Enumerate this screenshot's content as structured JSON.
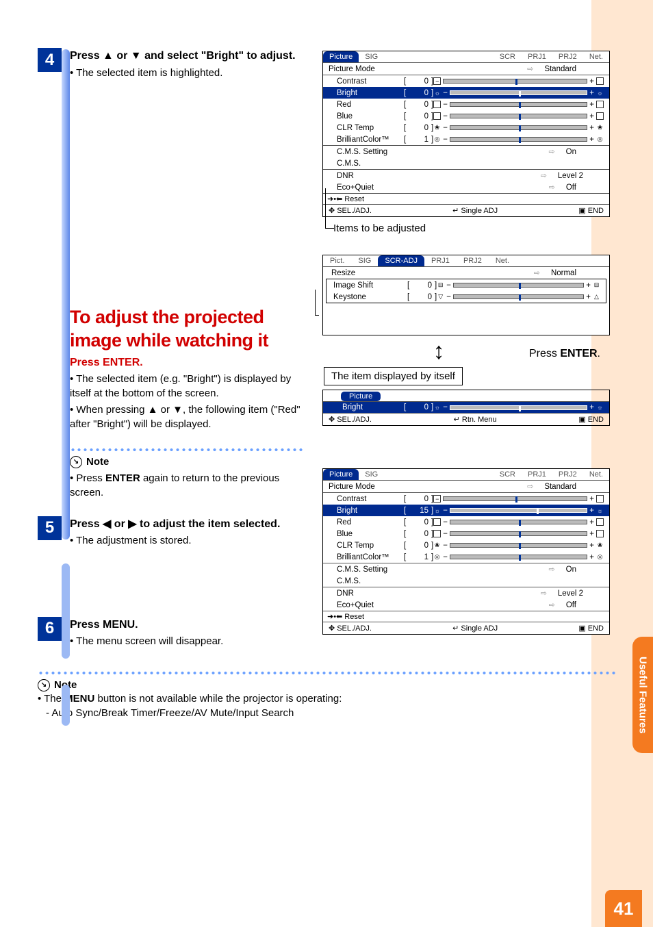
{
  "page_number": "41",
  "side_tab": "Useful Features",
  "step4": {
    "num": "4",
    "title_a": "Press ",
    "title_b": " or ",
    "title_c": " and select \"Bright\" to adjust.",
    "bullet": "• The selected item is highlighted."
  },
  "heading_red": "To adjust the projected image while watching it",
  "sub_red": "Press ENTER.",
  "sub_bullets": [
    "• The selected item (e.g. \"Bright\") is displayed by itself at the bottom of the screen.",
    "• When pressing ▲ or ▼, the following item (\"Red\" after \"Bright\") will be displayed."
  ],
  "note1": {
    "label": "Note",
    "text": "• Press ENTER again to return to the previous screen."
  },
  "step5": {
    "num": "5",
    "title_a": "Press ",
    "title_b": " or ",
    "title_c": " to adjust the item selected.",
    "bullet": "• The adjustment is stored."
  },
  "step6": {
    "num": "6",
    "title": "Press MENU.",
    "bullet": "• The menu screen will disappear."
  },
  "osd_tabs": {
    "picture": "Picture",
    "pict": "Pict.",
    "sig": "SIG",
    "scr": "SCR",
    "scradj": "SCR-ADJ",
    "prj1": "PRJ1",
    "prj2": "PRJ2",
    "net": "Net."
  },
  "osd1": {
    "picture_mode": {
      "label": "Picture Mode",
      "value": "Standard"
    },
    "contrast": {
      "label": "Contrast",
      "value": "0"
    },
    "bright": {
      "label": "Bright",
      "value": "0"
    },
    "red": {
      "label": "Red",
      "value": "0"
    },
    "blue": {
      "label": "Blue",
      "value": "0"
    },
    "clr_temp": {
      "label": "CLR Temp",
      "value": "0"
    },
    "brilliant": {
      "label": "BrilliantColor™",
      "value": "1"
    },
    "cms_setting": {
      "label": "C.M.S. Setting",
      "value": "On"
    },
    "cms": {
      "label": "C.M.S."
    },
    "dnr": {
      "label": "DNR",
      "value": "Level 2"
    },
    "eco": {
      "label": "Eco+Quiet",
      "value": "Off"
    },
    "reset": "Reset",
    "foot_sel": "SEL./ADJ.",
    "foot_single": "Single ADJ",
    "foot_end": "END"
  },
  "items_caption": "Items to be adjusted",
  "scradj": {
    "resize": {
      "label": "Resize",
      "value": "Normal"
    },
    "image_shift": {
      "label": "Image Shift",
      "value": "0"
    },
    "keystone": {
      "label": "Keystone",
      "value": "0"
    }
  },
  "press_enter": "Press ENTER.",
  "boxlabel": "The item displayed by itself",
  "mini": {
    "picture": "Picture",
    "bright": "Bright",
    "val": "0",
    "foot_sel": "SEL./ADJ.",
    "foot_rtn": "Rtn. Menu",
    "foot_end": "END"
  },
  "osd3": {
    "picture_mode": {
      "label": "Picture Mode",
      "value": "Standard"
    },
    "contrast": {
      "label": "Contrast",
      "value": "0"
    },
    "bright": {
      "label": "Bright",
      "value": "15"
    },
    "red": {
      "label": "Red",
      "value": "0"
    },
    "blue": {
      "label": "Blue",
      "value": "0"
    },
    "clr_temp": {
      "label": "CLR Temp",
      "value": "0"
    },
    "brilliant": {
      "label": "BrilliantColor™",
      "value": "1"
    },
    "cms_setting": {
      "label": "C.M.S. Setting",
      "value": "On"
    },
    "cms": {
      "label": "C.M.S."
    },
    "dnr": {
      "label": "DNR",
      "value": "Level 2"
    },
    "eco": {
      "label": "Eco+Quiet",
      "value": "Off"
    },
    "reset": "Reset",
    "foot_sel": "SEL./ADJ.",
    "foot_single": "Single ADJ",
    "foot_end": "END"
  },
  "bottom_note": {
    "label": "Note",
    "line1_a": "• The ",
    "line1_b": "MENU",
    "line1_c": " button is not available while the projector is operating:",
    "line2": "- Auto Sync/Break Timer/Freeze/AV Mute/Input Search"
  }
}
